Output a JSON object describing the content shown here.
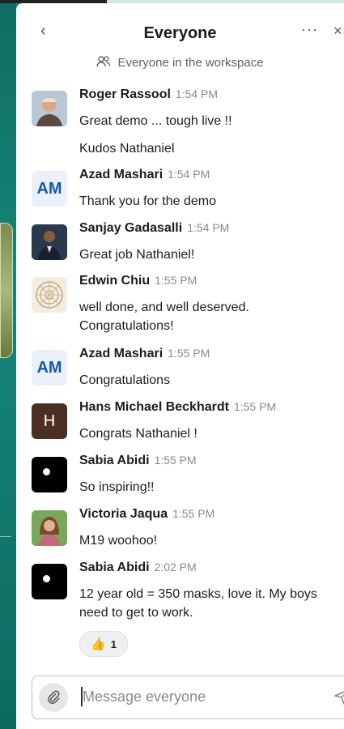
{
  "header": {
    "title": "Everyone",
    "subtitle": "Everyone in the workspace",
    "back_icon": "‹",
    "more_icon": "···",
    "close_icon": "×"
  },
  "messages": [
    {
      "author": "Roger Rassool",
      "time": "1:54 PM",
      "avatar": "photo",
      "lines": [
        "Great demo ... tough live !!",
        "Kudos Nathaniel"
      ]
    },
    {
      "author": "Azad Mashari",
      "time": "1:54 PM",
      "avatar": "AM",
      "lines": [
        "Thank you for the demo"
      ]
    },
    {
      "author": "Sanjay Gadasalli",
      "time": "1:54 PM",
      "avatar": "photo",
      "lines": [
        "Great job Nathaniel!"
      ]
    },
    {
      "author": "Edwin Chiu",
      "time": "1:55 PM",
      "avatar": "mandala",
      "lines": [
        "well done, and well deserved.",
        "Congratulations!"
      ]
    },
    {
      "author": "Azad Mashari",
      "time": "1:55 PM",
      "avatar": "AM",
      "lines": [
        "Congratulations"
      ]
    },
    {
      "author": "Hans Michael Beckhardt",
      "time": "1:55 PM",
      "avatar": "H",
      "lines": [
        "Congrats Nathaniel !"
      ]
    },
    {
      "author": "Sabia Abidi",
      "time": "1:55 PM",
      "avatar": "dot",
      "lines": [
        "So inspiring!!"
      ]
    },
    {
      "author": "Victoria Jaqua",
      "time": "1:55 PM",
      "avatar": "photo",
      "lines": [
        "M19 woohoo!"
      ]
    },
    {
      "author": "Sabia Abidi",
      "time": "2:02 PM",
      "avatar": "dot",
      "lines": [
        "12 year old = 350 masks, love it. My boys",
        "need to get to work."
      ]
    }
  ],
  "reaction": {
    "emoji": "👍",
    "count": "1"
  },
  "composer": {
    "placeholder": "Message everyone",
    "value": ""
  },
  "colors": {
    "accent": "#1a57a5",
    "workspace_bg": "#1a8a7a"
  }
}
